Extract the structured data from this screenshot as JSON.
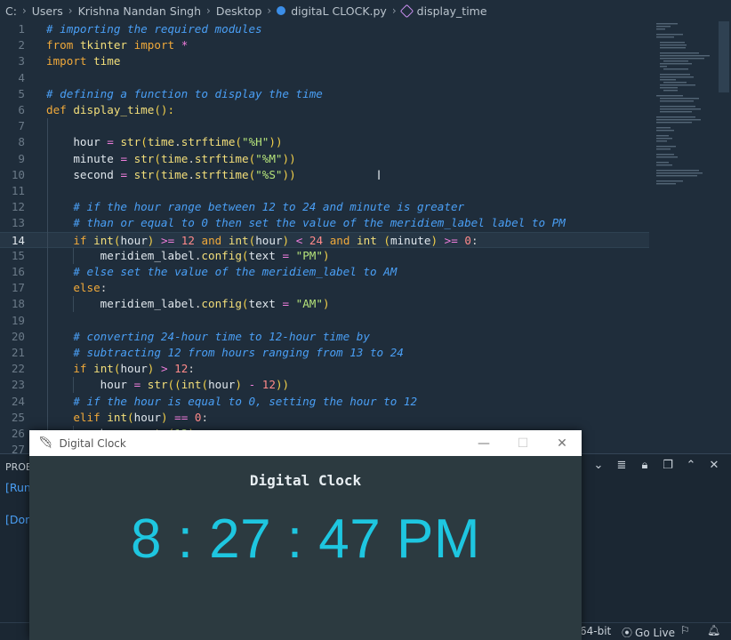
{
  "breadcrumb": {
    "items": [
      "C:",
      "Users",
      "Krishna Nandan Singh",
      "Desktop"
    ],
    "file": "digitaL CLOCK.py",
    "symbol": "display_time"
  },
  "editor": {
    "lines": [
      {
        "n": "1",
        "html": "<span class='c'># importing the required modules</span>"
      },
      {
        "n": "2",
        "html": "<span class='k'>from</span> <span class='f'>tkinter</span> <span class='k'>import</span> <span class='o'>*</span>"
      },
      {
        "n": "3",
        "html": "<span class='k'>import</span> <span class='f'>time</span>"
      },
      {
        "n": "4",
        "html": ""
      },
      {
        "n": "5",
        "html": "<span class='c'># defining a function to display the time</span>"
      },
      {
        "n": "6",
        "html": "<span class='k'>def</span> <span class='f'>display_time</span><span class='p'>():</span>"
      },
      {
        "n": "7",
        "html": ""
      },
      {
        "n": "8",
        "html": "    <span class='v'>hour</span> <span class='o'>=</span> <span class='f'>str</span><span class='p'>(</span><span class='f'>time</span>.<span class='f'>strftime</span><span class='p'>(</span><span class='s'>\"%H\"</span><span class='p'>))</span>"
      },
      {
        "n": "9",
        "html": "    <span class='v'>minute</span> <span class='o'>=</span> <span class='f'>str</span><span class='p'>(</span><span class='f'>time</span>.<span class='f'>strftime</span><span class='p'>(</span><span class='s'>\"%M\"</span><span class='p'>))</span>"
      },
      {
        "n": "10",
        "html": "    <span class='v'>second</span> <span class='o'>=</span> <span class='f'>str</span><span class='p'>(</span><span class='f'>time</span>.<span class='f'>strftime</span><span class='p'>(</span><span class='s'>\"%S\"</span><span class='p'>))</span>"
      },
      {
        "n": "11",
        "html": ""
      },
      {
        "n": "12",
        "html": "    <span class='c'># if the hour range between 12 to 24 and minute is greater</span>"
      },
      {
        "n": "13",
        "html": "    <span class='c'># than or equal to 0 then set the value of the meridiem_label label to PM</span>"
      },
      {
        "n": "14",
        "html": "    <span class='k'>if</span> <span class='f'>int</span><span class='p'>(</span><span class='v'>hour</span><span class='p'>)</span> <span class='o'>&gt;=</span> <span class='n'>12</span> <span class='k'>and</span> <span class='f'>int</span><span class='p'>(</span><span class='v'>hour</span><span class='p'>)</span> <span class='o'>&lt;</span> <span class='n'>24</span> <span class='k'>and</span> <span class='f'>int</span> <span class='p'>(</span><span class='v'>minute</span><span class='p'>)</span> <span class='o'>&gt;=</span> <span class='n'>0</span>:",
        "current": true
      },
      {
        "n": "15",
        "html": "        <span class='v'>meridiem_label</span>.<span class='f'>config</span><span class='p'>(</span><span class='v'>text</span> <span class='o'>=</span> <span class='s'>\"PM\"</span><span class='p'>)</span>"
      },
      {
        "n": "16",
        "html": "    <span class='c'># else set the value of the meridiem_label to AM</span>"
      },
      {
        "n": "17",
        "html": "    <span class='k'>else</span>:"
      },
      {
        "n": "18",
        "html": "        <span class='v'>meridiem_label</span>.<span class='f'>config</span><span class='p'>(</span><span class='v'>text</span> <span class='o'>=</span> <span class='s'>\"AM\"</span><span class='p'>)</span>"
      },
      {
        "n": "19",
        "html": ""
      },
      {
        "n": "20",
        "html": "    <span class='c'># converting 24-hour time to 12-hour time by</span>"
      },
      {
        "n": "21",
        "html": "    <span class='c'># subtracting 12 from hours ranging from 13 to 24</span>"
      },
      {
        "n": "22",
        "html": "    <span class='k'>if</span> <span class='f'>int</span><span class='p'>(</span><span class='v'>hour</span><span class='p'>)</span> <span class='o'>&gt;</span> <span class='n'>12</span>:"
      },
      {
        "n": "23",
        "html": "        <span class='v'>hour</span> <span class='o'>=</span> <span class='f'>str</span><span class='p'>((</span><span class='f'>int</span><span class='p'>(</span><span class='v'>hour</span><span class='p'>)</span> <span class='o'>-</span> <span class='n'>12</span><span class='p'>))</span>"
      },
      {
        "n": "24",
        "html": "    <span class='c'># if the hour is equal to 0, setting the hour to 12</span>"
      },
      {
        "n": "25",
        "html": "    <span class='k'>elif</span> <span class='f'>int</span><span class='p'>(</span><span class='v'>hour</span><span class='p'>)</span> <span class='o'>==</span> <span class='n'>0</span>:"
      },
      {
        "n": "26",
        "html": "        <span class='v'>hour</span> <span class='o'>=</span> <span class='f'>str</span><span class='p'>(</span><span class='s'>12</span><span class='p'>)</span>"
      },
      {
        "n": "27",
        "html": ""
      }
    ]
  },
  "panel": {
    "title": "PROBL",
    "line1": "[Run",
    "line2": "[Don"
  },
  "statusbar": {
    "arch": "64-bit",
    "golive": "Go Live"
  },
  "tk": {
    "window_title": "Digital Clock",
    "heading": "Digital Clock",
    "time": "8 : 27 : 47 PM"
  },
  "colors": {
    "editor_bg": "#1f2d3b",
    "clock_fg": "#1ec6e0",
    "tk_bg": "#2c3a40"
  }
}
